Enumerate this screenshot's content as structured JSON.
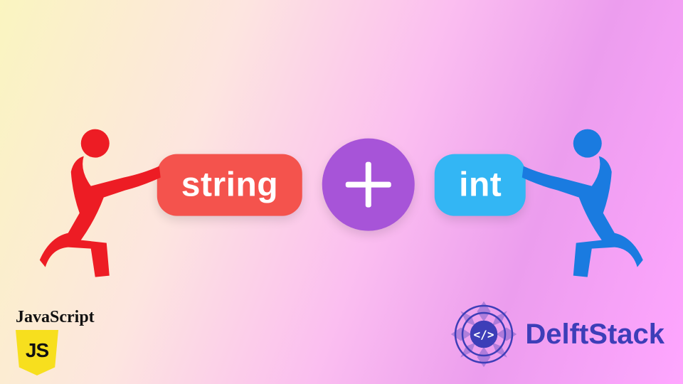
{
  "diagram": {
    "left_pill": "string",
    "operator": "+",
    "right_pill": "int",
    "left_figure": "red pushing figure",
    "right_figure": "blue pushing figure"
  },
  "badges": {
    "javascript_label": "JavaScript",
    "javascript_shield": "JS",
    "delftstack_brand": "DelftStack"
  },
  "colors": {
    "pill_red": "#f4534d",
    "pill_blue": "#33b6f4",
    "operator_circle": "#a754d8",
    "figure_red": "#ed1c24",
    "figure_blue": "#1a7be0",
    "js_yellow": "#f7df1e",
    "delft_purple": "#3d3eb8"
  }
}
